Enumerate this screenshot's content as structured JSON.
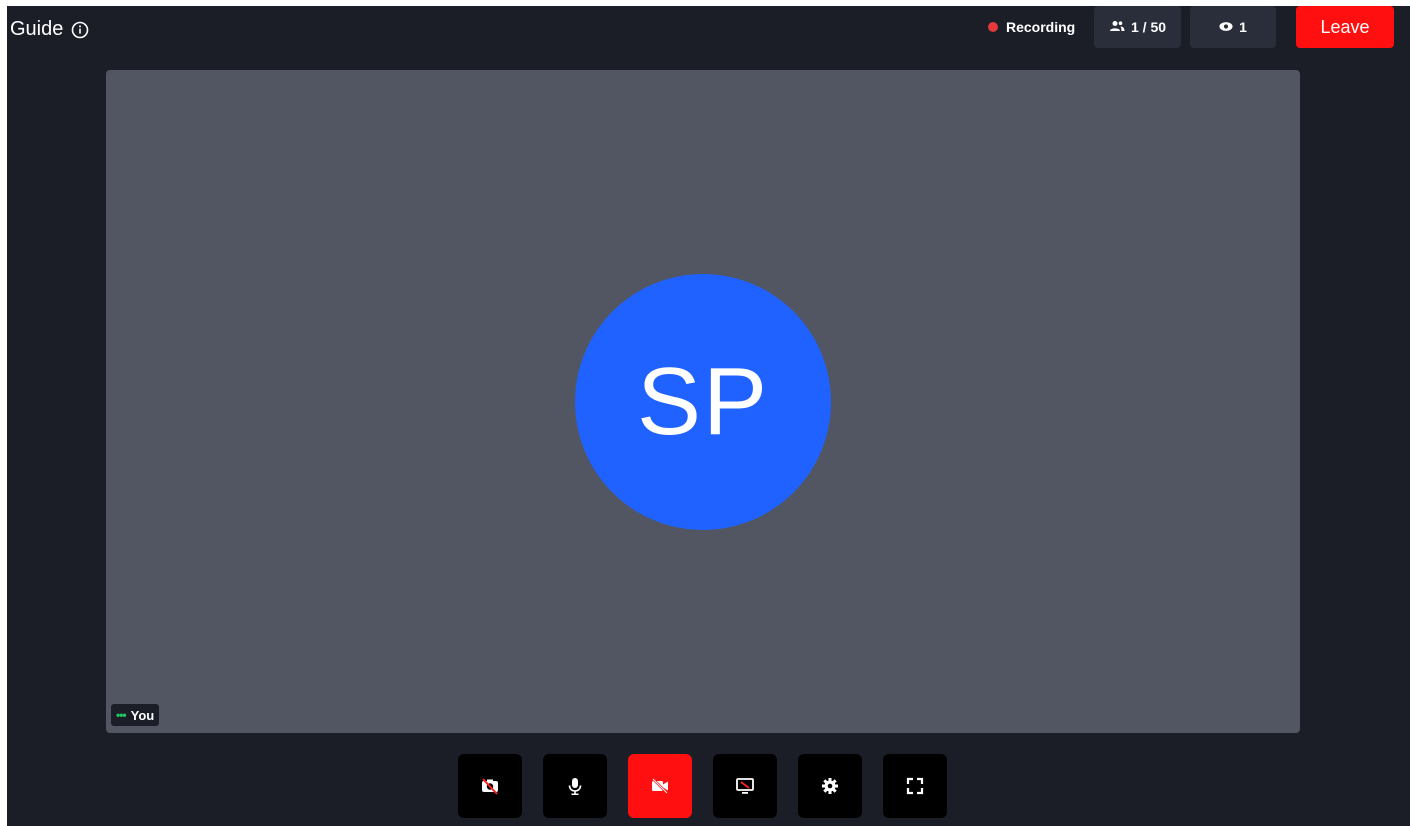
{
  "header": {
    "title": "Guide",
    "title_icon": "info-icon",
    "recording_label": "Recording",
    "participants": "1 / 50",
    "participants_icon": "users-icon",
    "viewers": "1",
    "viewers_icon": "eye-icon",
    "leave_label": "Leave"
  },
  "tile": {
    "initials": "SP",
    "name": "You",
    "status_icon": "speaking-dots-icon"
  },
  "controls": [
    {
      "name": "camera-off-button",
      "icon": "camera-off-icon"
    },
    {
      "name": "microphone-button",
      "icon": "microphone-icon"
    },
    {
      "name": "video-off-button",
      "icon": "video-off-icon",
      "color": "#ff0f0f"
    },
    {
      "name": "screen-share-button",
      "icon": "screen-share-icon"
    },
    {
      "name": "settings-button",
      "icon": "gear-icon"
    },
    {
      "name": "fullscreen-button",
      "icon": "fullscreen-icon"
    }
  ],
  "colors": {
    "background": "#1b1e27",
    "tile": "#515662",
    "avatar": "#1f62ff",
    "leave": "#ff0f0f",
    "recording_dot": "#e5383b",
    "speaking": "#22c55e"
  }
}
